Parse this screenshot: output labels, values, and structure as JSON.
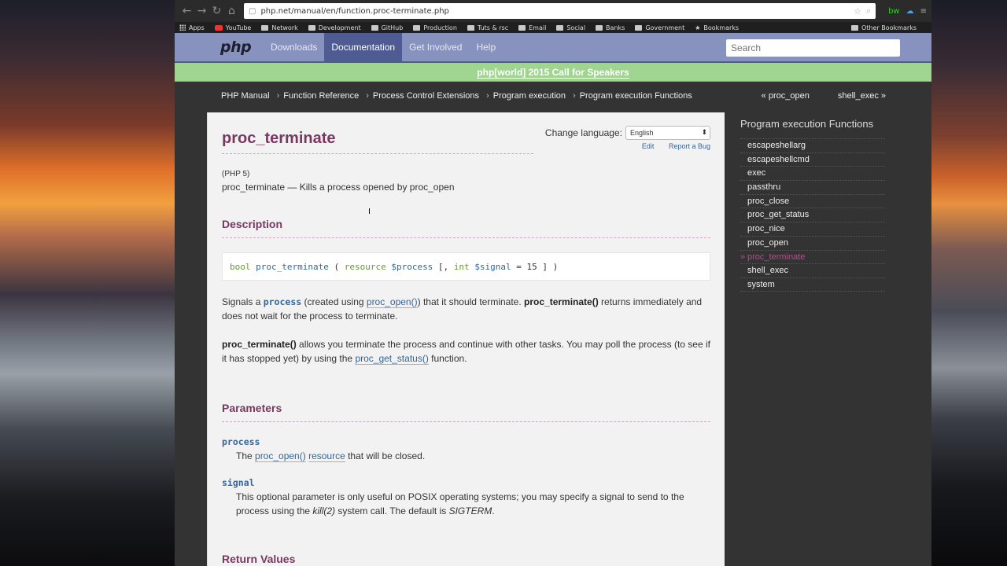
{
  "browser": {
    "url": "php.net/manual/en/function.proc-terminate.php",
    "bookmarks": [
      "Apps",
      "YouTube",
      "Network",
      "Development",
      "GitHub",
      "Production",
      "Tuts & rsc",
      "Email",
      "Social",
      "Banks",
      "Government",
      "Bookmarks"
    ],
    "other_bookmarks": "Other Bookmarks"
  },
  "header": {
    "logo": "php",
    "nav": [
      "Downloads",
      "Documentation",
      "Get Involved",
      "Help"
    ],
    "active_nav": "Documentation",
    "search_placeholder": "Search"
  },
  "banner": "php[world] 2015 Call for Speakers",
  "breadcrumbs": [
    "PHP Manual",
    "Function Reference",
    "Process Control Extensions",
    "Program execution",
    "Program execution Functions"
  ],
  "prev_link": "« proc_open",
  "next_link": "shell_exec »",
  "page": {
    "title": "proc_terminate",
    "change_language_label": "Change language:",
    "language_selected": "English",
    "edit_link": "Edit",
    "report_bug_link": "Report a Bug",
    "version": "(PHP 5)",
    "refpurpose": "proc_terminate — Kills a process opened by proc_open",
    "description_heading": "Description",
    "synopsis": {
      "return_type": "bool",
      "name": "proc_terminate",
      "open": " ( ",
      "arg1_type": "resource",
      "arg1_var": "$process",
      "opt_open": " [, ",
      "arg2_type": "int",
      "arg2_var": "$signal",
      "arg2_default": " = 15",
      "close": " ] )"
    },
    "para1": {
      "t1": "Signals a ",
      "process": "process",
      "t2": " (created using ",
      "proc_open_link": "proc_open()",
      "t3": ") that it should terminate. ",
      "fn_bold": "proc_terminate()",
      "t4": " returns immediately and does not wait for the process to terminate."
    },
    "para2": {
      "fn_bold": "proc_terminate()",
      "t1": " allows you terminate the process and continue with other tasks. You may poll the process (to see if it has stopped yet) by using the ",
      "status_link": "proc_get_status()",
      "t2": " function."
    },
    "parameters_heading": "Parameters",
    "params": [
      {
        "name": "process",
        "pre": "The ",
        "link1": "proc_open()",
        "link2": "resource",
        "post": " that will be closed."
      },
      {
        "name": "signal",
        "t1": "This optional parameter is only useful on POSIX operating systems; you may specify a signal to send to the process using the ",
        "kill": "kill(2)",
        "t2": " system call. The default is ",
        "sigterm": "SIGTERM",
        "t3": "."
      }
    ],
    "return_heading": "Return Values"
  },
  "sidebar": {
    "title": "Program execution Functions",
    "items": [
      "escapeshellarg",
      "escapeshellcmd",
      "exec",
      "passthru",
      "proc_close",
      "proc_get_status",
      "proc_nice",
      "proc_open",
      "proc_terminate",
      "shell_exec",
      "system"
    ],
    "current": "proc_terminate"
  },
  "colors": {
    "header_bg": "#8892bf",
    "active_nav_bg": "#4f5b93",
    "banner_bg": "#9fd491",
    "title_color": "#793862",
    "link_color": "#336699"
  }
}
